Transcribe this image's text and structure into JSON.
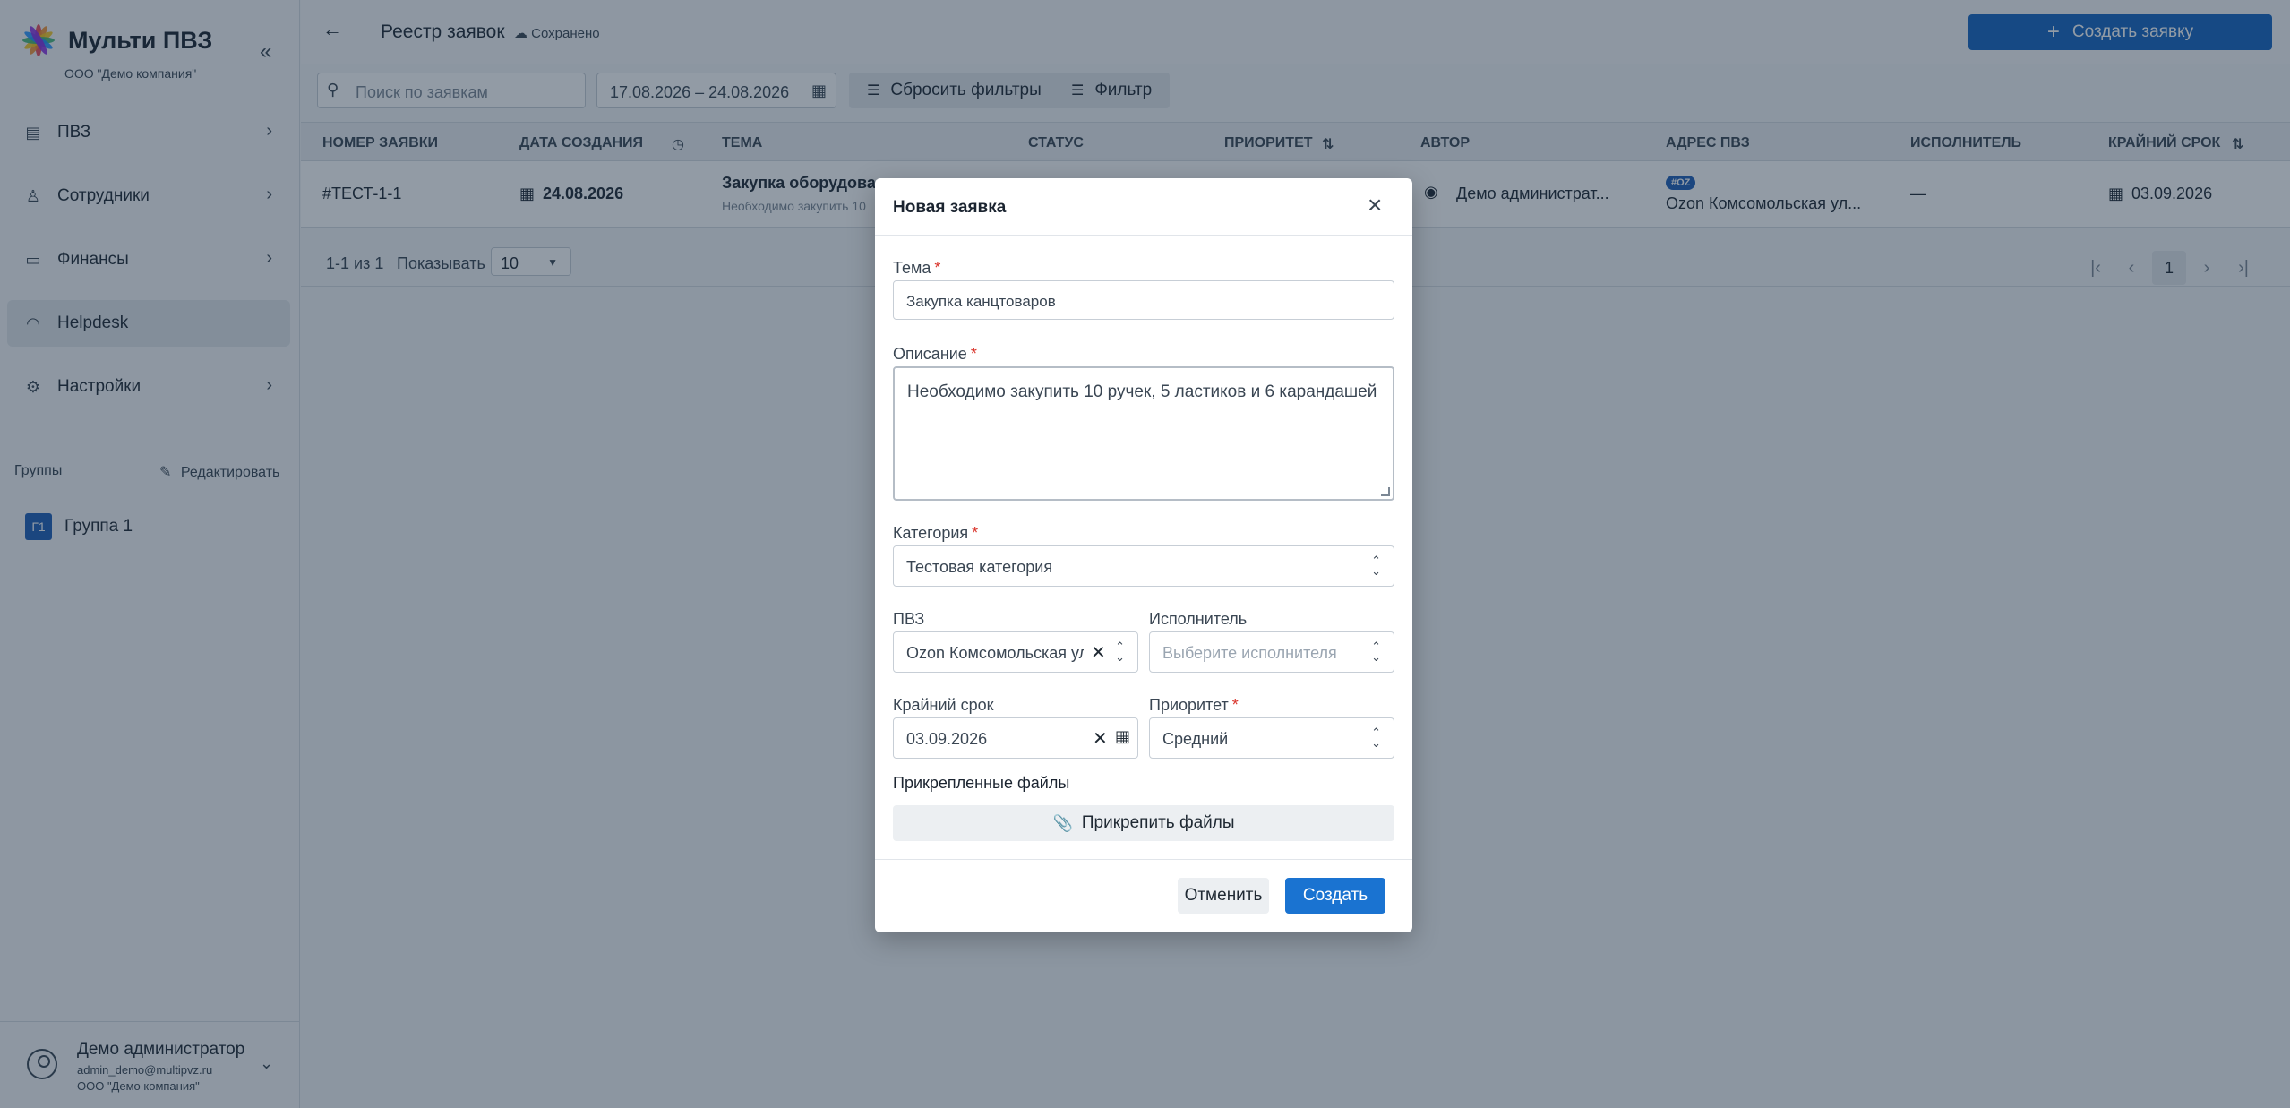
{
  "sidebar": {
    "brand": "Мульти ПВЗ",
    "company": "ООО \"Демо компания\"",
    "items": [
      {
        "label": "ПВЗ",
        "icon": "store-icon"
      },
      {
        "label": "Сотрудники",
        "icon": "user-icon"
      },
      {
        "label": "Финансы",
        "icon": "card-icon"
      },
      {
        "label": "Helpdesk",
        "icon": "headset-icon"
      },
      {
        "label": "Настройки",
        "icon": "gear-icon"
      }
    ],
    "groups_label": "Группы",
    "groups_edit": "Редактировать",
    "group": {
      "badge": "Г1",
      "label": "Группа 1"
    },
    "user": {
      "name": "Демо администратор",
      "email": "admin_demo@multipvz.ru",
      "company": "ООО \"Демо компания\""
    }
  },
  "header": {
    "title": "Реестр заявок",
    "saved": "Сохранено",
    "create_button": "Создать заявку"
  },
  "filters": {
    "search_placeholder": "Поиск по заявкам",
    "date_range": "17.08.2026 – 24.08.2026",
    "reset_button": "Сбросить фильтры",
    "filter_button": "Фильтр"
  },
  "table": {
    "columns": [
      "НОМЕР ЗАЯВКИ",
      "ДАТА СОЗДАНИЯ",
      "ТЕМА",
      "СТАТУС",
      "ПРИОРИТЕТ",
      "АВТОР",
      "АДРЕС ПВЗ",
      "ИСПОЛНИТЕЛЬ",
      "КРАЙНИЙ СРОК"
    ],
    "row": {
      "number": "#ТЕСТ-1-1",
      "created": "24.08.2026",
      "subject": "Закупка оборудован",
      "subject_sub": "Необходимо закупить 10",
      "author": "Демо администрат...",
      "pvz_badge": "#OZ",
      "pvz_address": "Ozon Комсомольская ул...",
      "executor": "—",
      "deadline": "03.09.2026"
    }
  },
  "pager": {
    "range": "1-1 из 1",
    "show_label": "Показывать",
    "per_page": "10",
    "page": "1"
  },
  "modal": {
    "title": "Новая заявка",
    "subject_label": "Тема",
    "subject_value": "Закупка канцтоваров",
    "description_label": "Описание",
    "description_value": "Необходимо закупить 10 ручек, 5 ластиков и 6 карандашей",
    "category_label": "Категория",
    "category_value": "Тестовая категория",
    "pvz_label": "ПВЗ",
    "pvz_value": "Ozon Комсомольская улица",
    "executor_label": "Исполнитель",
    "executor_placeholder": "Выберите исполнителя",
    "deadline_label": "Крайний срок",
    "deadline_value": "03.09.2026",
    "priority_label": "Приоритет",
    "priority_value": "Средний",
    "files_label": "Прикрепленные файлы",
    "attach_button": "Прикрепить файлы",
    "cancel_button": "Отменить",
    "create_button": "Создать",
    "required_mark": "*"
  },
  "colors": {
    "accent": "#1565c0",
    "required": "#d9342b"
  }
}
